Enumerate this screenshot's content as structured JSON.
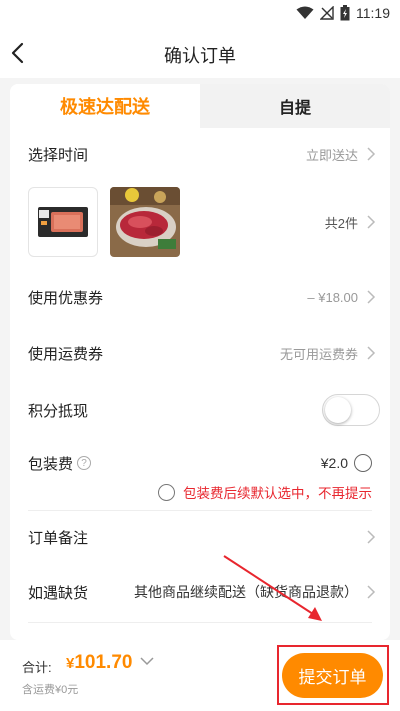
{
  "status_bar": {
    "time": "11:19",
    "battery_icon": "battery-icon",
    "wifi_icon": "wifi-icon",
    "signal_icon": "no-signal-icon"
  },
  "header": {
    "title": "确认订单",
    "back_icon": "chevron-left-icon"
  },
  "tabs": [
    {
      "label": "极速达配送",
      "active": true
    },
    {
      "label": "自提",
      "active": false
    }
  ],
  "rows": {
    "time": {
      "label": "选择时间",
      "value": "立即送达"
    },
    "items": {
      "count_text": "共2件"
    },
    "coupon": {
      "label": "使用优惠券",
      "value": "– ¥18.00"
    },
    "shipping_coupon": {
      "label": "使用运费券",
      "value": "无可用运费券"
    },
    "points": {
      "label": "积分抵现",
      "enabled": false
    },
    "packaging": {
      "label": "包装费",
      "help_glyph": "?",
      "value": "¥2.0"
    },
    "packaging_hint": {
      "text": "包装费后续默认选中，不再提示"
    },
    "remark": {
      "label": "订单备注"
    },
    "out_of_stock": {
      "label": "如遇缺货",
      "value": "其他商品继续配送（缺货商品退款）"
    }
  },
  "footer": {
    "total_label": "合计:",
    "currency": "¥",
    "total_value": "101.70",
    "fee_note": "含运费¥0元",
    "submit_label": "提交订单"
  },
  "colors": {
    "accent": "#ff8a00",
    "warning": "#e8262e",
    "background": "#f4f4f4"
  }
}
